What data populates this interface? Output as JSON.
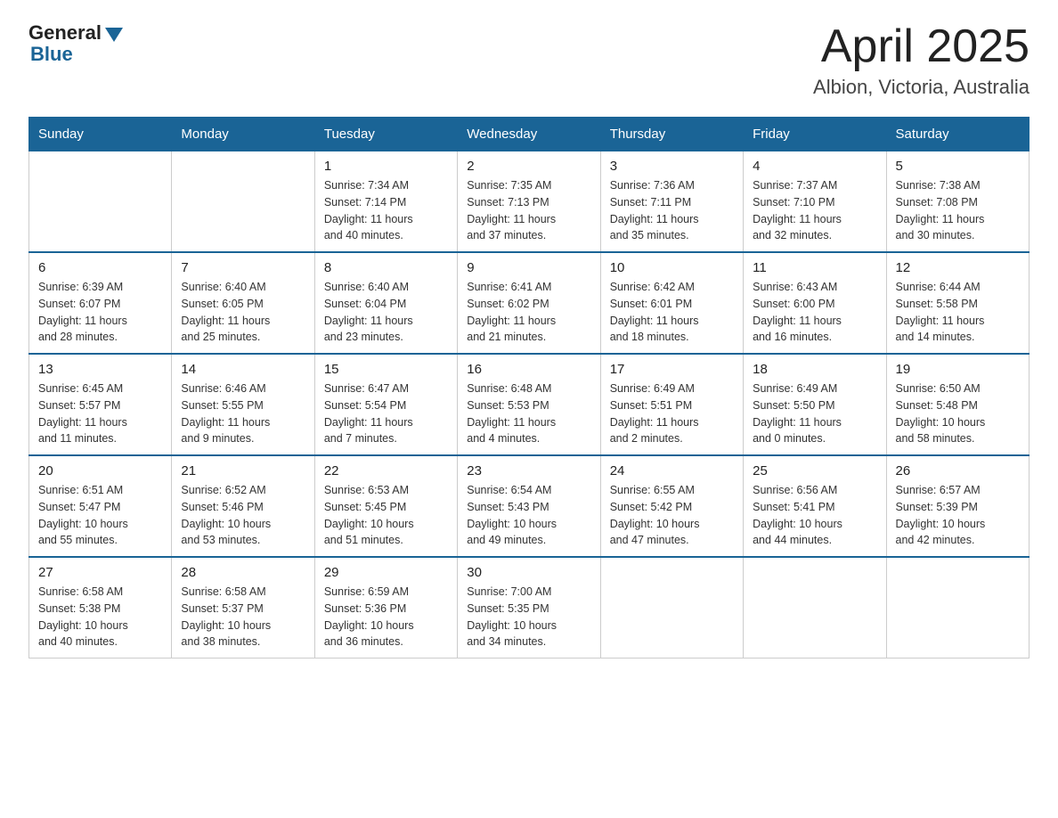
{
  "logo": {
    "general": "General",
    "blue": "Blue"
  },
  "title": "April 2025",
  "subtitle": "Albion, Victoria, Australia",
  "days_of_week": [
    "Sunday",
    "Monday",
    "Tuesday",
    "Wednesday",
    "Thursday",
    "Friday",
    "Saturday"
  ],
  "weeks": [
    [
      {
        "day": "",
        "info": ""
      },
      {
        "day": "",
        "info": ""
      },
      {
        "day": "1",
        "info": "Sunrise: 7:34 AM\nSunset: 7:14 PM\nDaylight: 11 hours\nand 40 minutes."
      },
      {
        "day": "2",
        "info": "Sunrise: 7:35 AM\nSunset: 7:13 PM\nDaylight: 11 hours\nand 37 minutes."
      },
      {
        "day": "3",
        "info": "Sunrise: 7:36 AM\nSunset: 7:11 PM\nDaylight: 11 hours\nand 35 minutes."
      },
      {
        "day": "4",
        "info": "Sunrise: 7:37 AM\nSunset: 7:10 PM\nDaylight: 11 hours\nand 32 minutes."
      },
      {
        "day": "5",
        "info": "Sunrise: 7:38 AM\nSunset: 7:08 PM\nDaylight: 11 hours\nand 30 minutes."
      }
    ],
    [
      {
        "day": "6",
        "info": "Sunrise: 6:39 AM\nSunset: 6:07 PM\nDaylight: 11 hours\nand 28 minutes."
      },
      {
        "day": "7",
        "info": "Sunrise: 6:40 AM\nSunset: 6:05 PM\nDaylight: 11 hours\nand 25 minutes."
      },
      {
        "day": "8",
        "info": "Sunrise: 6:40 AM\nSunset: 6:04 PM\nDaylight: 11 hours\nand 23 minutes."
      },
      {
        "day": "9",
        "info": "Sunrise: 6:41 AM\nSunset: 6:02 PM\nDaylight: 11 hours\nand 21 minutes."
      },
      {
        "day": "10",
        "info": "Sunrise: 6:42 AM\nSunset: 6:01 PM\nDaylight: 11 hours\nand 18 minutes."
      },
      {
        "day": "11",
        "info": "Sunrise: 6:43 AM\nSunset: 6:00 PM\nDaylight: 11 hours\nand 16 minutes."
      },
      {
        "day": "12",
        "info": "Sunrise: 6:44 AM\nSunset: 5:58 PM\nDaylight: 11 hours\nand 14 minutes."
      }
    ],
    [
      {
        "day": "13",
        "info": "Sunrise: 6:45 AM\nSunset: 5:57 PM\nDaylight: 11 hours\nand 11 minutes."
      },
      {
        "day": "14",
        "info": "Sunrise: 6:46 AM\nSunset: 5:55 PM\nDaylight: 11 hours\nand 9 minutes."
      },
      {
        "day": "15",
        "info": "Sunrise: 6:47 AM\nSunset: 5:54 PM\nDaylight: 11 hours\nand 7 minutes."
      },
      {
        "day": "16",
        "info": "Sunrise: 6:48 AM\nSunset: 5:53 PM\nDaylight: 11 hours\nand 4 minutes."
      },
      {
        "day": "17",
        "info": "Sunrise: 6:49 AM\nSunset: 5:51 PM\nDaylight: 11 hours\nand 2 minutes."
      },
      {
        "day": "18",
        "info": "Sunrise: 6:49 AM\nSunset: 5:50 PM\nDaylight: 11 hours\nand 0 minutes."
      },
      {
        "day": "19",
        "info": "Sunrise: 6:50 AM\nSunset: 5:48 PM\nDaylight: 10 hours\nand 58 minutes."
      }
    ],
    [
      {
        "day": "20",
        "info": "Sunrise: 6:51 AM\nSunset: 5:47 PM\nDaylight: 10 hours\nand 55 minutes."
      },
      {
        "day": "21",
        "info": "Sunrise: 6:52 AM\nSunset: 5:46 PM\nDaylight: 10 hours\nand 53 minutes."
      },
      {
        "day": "22",
        "info": "Sunrise: 6:53 AM\nSunset: 5:45 PM\nDaylight: 10 hours\nand 51 minutes."
      },
      {
        "day": "23",
        "info": "Sunrise: 6:54 AM\nSunset: 5:43 PM\nDaylight: 10 hours\nand 49 minutes."
      },
      {
        "day": "24",
        "info": "Sunrise: 6:55 AM\nSunset: 5:42 PM\nDaylight: 10 hours\nand 47 minutes."
      },
      {
        "day": "25",
        "info": "Sunrise: 6:56 AM\nSunset: 5:41 PM\nDaylight: 10 hours\nand 44 minutes."
      },
      {
        "day": "26",
        "info": "Sunrise: 6:57 AM\nSunset: 5:39 PM\nDaylight: 10 hours\nand 42 minutes."
      }
    ],
    [
      {
        "day": "27",
        "info": "Sunrise: 6:58 AM\nSunset: 5:38 PM\nDaylight: 10 hours\nand 40 minutes."
      },
      {
        "day": "28",
        "info": "Sunrise: 6:58 AM\nSunset: 5:37 PM\nDaylight: 10 hours\nand 38 minutes."
      },
      {
        "day": "29",
        "info": "Sunrise: 6:59 AM\nSunset: 5:36 PM\nDaylight: 10 hours\nand 36 minutes."
      },
      {
        "day": "30",
        "info": "Sunrise: 7:00 AM\nSunset: 5:35 PM\nDaylight: 10 hours\nand 34 minutes."
      },
      {
        "day": "",
        "info": ""
      },
      {
        "day": "",
        "info": ""
      },
      {
        "day": "",
        "info": ""
      }
    ]
  ]
}
